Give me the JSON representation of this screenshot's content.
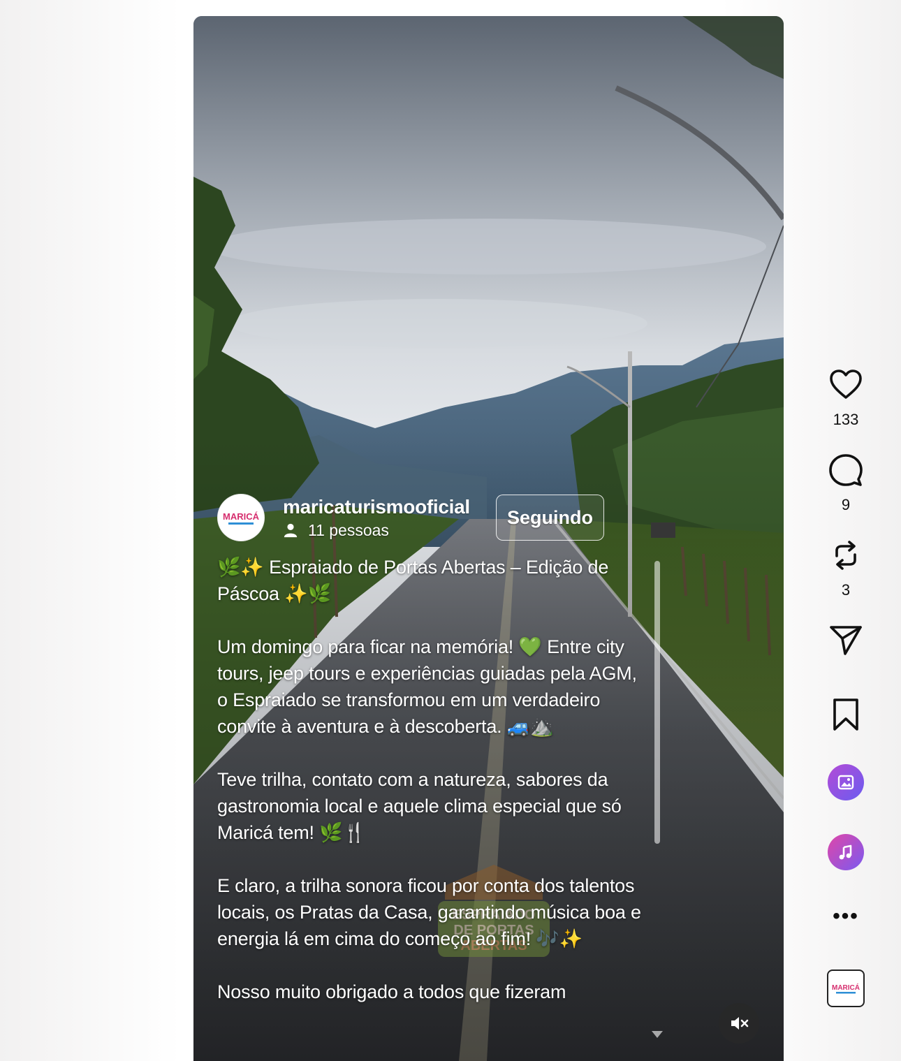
{
  "post": {
    "author": "maricaturismooficial",
    "collaborators": "11 pessoas",
    "follow_label": "Seguindo",
    "avatar_logo_text": "MARICÁ",
    "watermark_text": [
      "ESPRAIADO",
      "DE PORTAS",
      "ABERTAS"
    ],
    "caption": [
      "🌿✨ Espraiado de Portas Abertas – Edição de Páscoa ✨🌿",
      "Um domingo para ficar na memória! 💚 Entre city tours, jeep tours e experiências guiadas pela AGM, o Espraiado se transformou em um verdadeiro convite à aventura e à descoberta. 🚙⛰️",
      "Teve trilha, contato com a natureza, sabores da gastronomia local e aquele clima especial que só Maricá tem! 🌿🍴",
      "E claro, a trilha sonora ficou por conta dos talentos locais, os Pratas da Casa, garantindo música boa e energia lá em cima do começo ao fim! 🎶✨",
      "Nosso muito obrigado a todos que fizeram"
    ]
  },
  "actions": {
    "like_count": "133",
    "comment_count": "9",
    "repost_count": "3"
  },
  "icons": {
    "like": "heart-icon",
    "comment": "comment-bubble-icon",
    "repost": "repost-icon",
    "share": "send-icon",
    "save": "bookmark-icon",
    "photo_app": "gallery-icon",
    "music_app": "music-note-icon",
    "more": "more-icon",
    "mute": "speaker-muted-icon"
  },
  "colors": {
    "photo_badge": "#8a53e6",
    "music_badge": "#b04bd8",
    "text_dark": "#111111"
  }
}
